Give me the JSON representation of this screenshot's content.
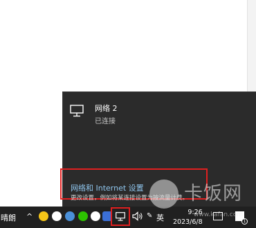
{
  "flyout": {
    "network_name": "网络 2",
    "network_status": "已连接",
    "settings_link": "网络和 Internet 设置",
    "settings_desc": "更改设置，例如将某连接设置为按流量计费。"
  },
  "taskbar": {
    "weather": "晴朗",
    "tray_arrow": "^",
    "ime": "英",
    "time": "9:26",
    "date": "2023/6/8",
    "notification_count": "1"
  },
  "watermark": {
    "text": "卡饭网",
    "url": "www.kafan.com"
  },
  "colors": {
    "flyout_bg": "#2b2b2b",
    "taskbar_bg": "#202020",
    "link": "#8fc6ee",
    "highlight": "#e02020"
  },
  "icons": [
    "network-icon",
    "volume-icon",
    "pen-icon",
    "notification-icon",
    "media-icon"
  ]
}
